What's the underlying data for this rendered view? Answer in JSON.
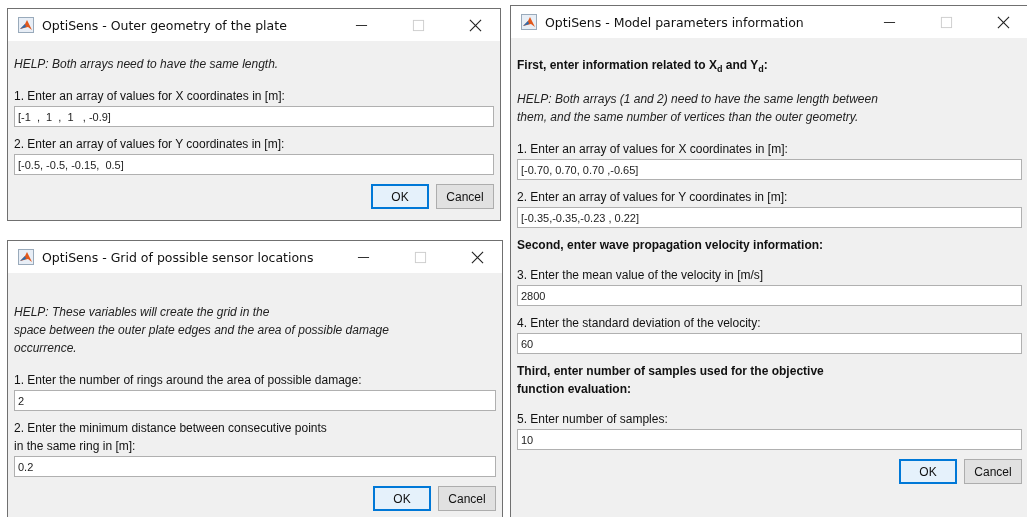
{
  "windows": [
    {
      "title": "OptiSens - Outer geometry of the plate",
      "blocks": [
        {
          "kind": "help",
          "text": "HELP: Both arrays need to have the same length."
        },
        {
          "kind": "field",
          "label": "1. Enter an array of values for X coordinates in [m]:",
          "value": "[-1  ,  1  ,  1   , -0.9]"
        },
        {
          "kind": "field",
          "label": "2. Enter an array of values for Y coordinates in [m]:",
          "value": "[-0.5, -0.5, -0.15,  0.5]"
        }
      ],
      "buttons": [
        {
          "label": "OK",
          "default": true
        },
        {
          "label": "Cancel",
          "default": false
        }
      ]
    },
    {
      "title": "OptiSens - Grid of possible sensor locations",
      "blocks": [
        {
          "kind": "help",
          "text": "HELP: These variables will create the grid in the\nspace between the outer plate edges and the area of possible damage\noccurrence."
        },
        {
          "kind": "field",
          "label": "1. Enter the number of rings around the area of possible damage:",
          "value": "2"
        },
        {
          "kind": "field",
          "label": "2. Enter the minimum distance between consecutive points\nin the same ring in [m]:",
          "value": "0.2"
        }
      ],
      "buttons": [
        {
          "label": "OK",
          "default": true
        },
        {
          "label": "Cancel",
          "default": false
        }
      ]
    },
    {
      "title": "OptiSens - Model parameters information",
      "blocks": [
        {
          "kind": "heading",
          "text": "First, enter information related to X$_{d}$ and Y$_{d}$:"
        },
        {
          "kind": "help",
          "text": " HELP: Both arrays (1 and 2) need to have the same length between\nthem, and the same number of vertices than the outer geometry."
        },
        {
          "kind": "field",
          "label": " 1. Enter an array of values for X coordinates in [m]:",
          "value": "[-0.70, 0.70, 0.70 ,-0.65]"
        },
        {
          "kind": "field",
          "label": " 2. Enter an array of values for Y coordinates in [m]:",
          "value": "[-0.35,-0.35,-0.23 , 0.22]"
        },
        {
          "kind": "heading",
          "text": "Second, enter wave propagation velocity information:"
        },
        {
          "kind": "field",
          "label": " 3. Enter the mean value of the velocity in [m/s]",
          "value": "2800"
        },
        {
          "kind": "field",
          "label": " 4. Enter the standard deviation of the velocity:",
          "value": "60"
        },
        {
          "kind": "heading",
          "text": "Third, enter number of samples used for the objective\nfunction evaluation:"
        },
        {
          "kind": "field",
          "label": " 5. Enter number of samples:",
          "value": "10"
        }
      ],
      "buttons": [
        {
          "label": "OK",
          "default": true
        },
        {
          "label": "Cancel",
          "default": false
        }
      ]
    }
  ]
}
